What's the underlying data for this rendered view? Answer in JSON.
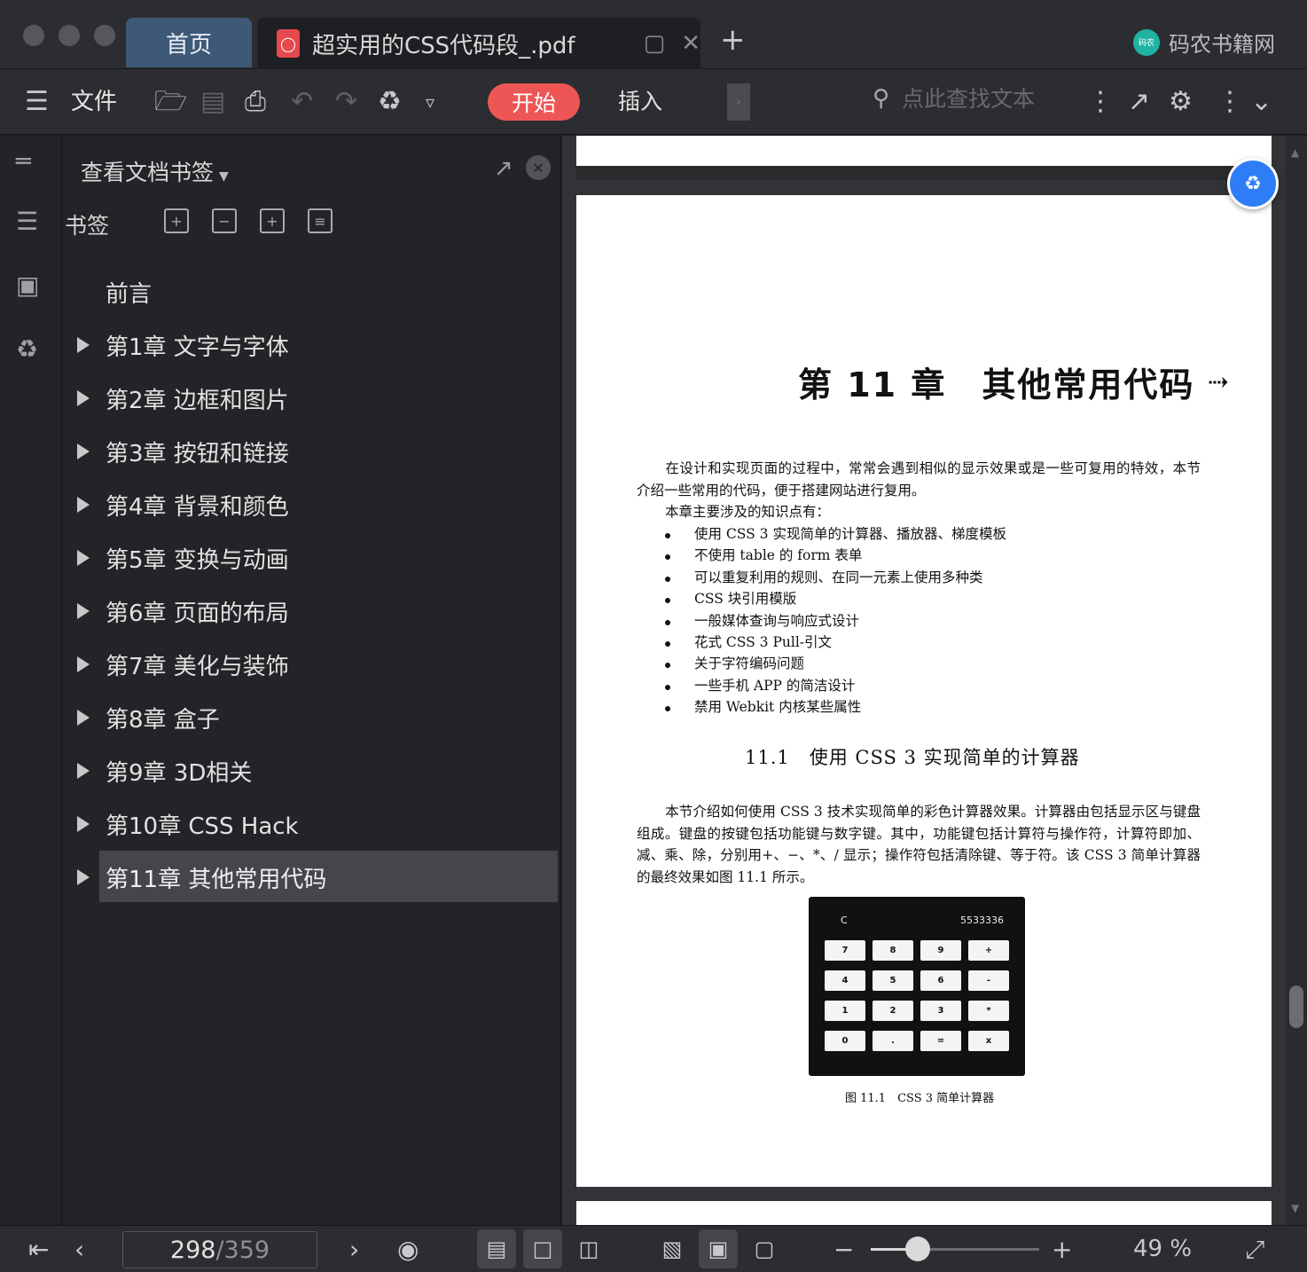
{
  "tabs": {
    "home": "首页",
    "document": "超实用的CSS代码段_.pdf",
    "brand": "码农书籍网",
    "brand_logo_text": "码农"
  },
  "toolbar": {
    "file_label": "文件",
    "start_label": "开始",
    "insert_label": "插入",
    "search_placeholder": "点此查找文本"
  },
  "panel": {
    "title": "查看文档书签",
    "bookmark_label": "书签",
    "bookmarks": [
      {
        "label": "前言",
        "expandable": false,
        "selected": false
      },
      {
        "label": "第1章 文字与字体",
        "expandable": true,
        "selected": false
      },
      {
        "label": "第2章 边框和图片",
        "expandable": true,
        "selected": false
      },
      {
        "label": "第3章 按钮和链接",
        "expandable": true,
        "selected": false
      },
      {
        "label": "第4章 背景和颜色",
        "expandable": true,
        "selected": false
      },
      {
        "label": "第5章 变换与动画",
        "expandable": true,
        "selected": false
      },
      {
        "label": "第6章 页面的布局",
        "expandable": true,
        "selected": false
      },
      {
        "label": "第7章 美化与装饰",
        "expandable": true,
        "selected": false
      },
      {
        "label": "第8章 盒子",
        "expandable": true,
        "selected": false
      },
      {
        "label": "第9章 3D相关",
        "expandable": true,
        "selected": false
      },
      {
        "label": "第10章 CSS Hack",
        "expandable": true,
        "selected": false
      },
      {
        "label": "第11章 其他常用代码",
        "expandable": true,
        "selected": true
      }
    ]
  },
  "document": {
    "chapter_title": "第 11 章　其他常用代码",
    "intro_line1": "在设计和实现页面的过程中，常常会遇到相似的显示效果或是一些可复用的特效，本节介绍一些常用的代码，便于搭建网站进行复用。",
    "intro_line2": "本章主要涉及的知识点有：",
    "bullets": [
      "使用 CSS 3 实现简单的计算器、播放器、梯度模板",
      "不使用 table 的 form 表单",
      "可以重复利用的规则、在同一元素上使用多种类",
      "CSS 块引用模版",
      "一般媒体查询与响应式设计",
      "花式 CSS 3 Pull-引文",
      "关于字符编码问题",
      "一些手机 APP 的简洁设计",
      "禁用 Webkit 内核某些属性"
    ],
    "section_title": "11.1　使用 CSS 3 实现简单的计算器",
    "section_para": "本节介绍如何使用 CSS 3 技术实现简单的彩色计算器效果。计算器由包括显示区与键盘组成。键盘的按键包括功能键与数字键。其中，功能键包括计算符与操作符，计算符即加、减、乘、除，分别用+、−、*、/ 显示；操作符包括清除键、等于符。该 CSS 3 简单计算器的最终效果如图 11.1 所示。",
    "calculator": {
      "clear": "C",
      "display": "5533336",
      "keys": [
        "7",
        "8",
        "9",
        "+",
        "4",
        "5",
        "6",
        "-",
        "1",
        "2",
        "3",
        "*",
        "0",
        ".",
        "=",
        "x"
      ]
    },
    "figure_caption": "图 11.1　CSS 3 简单计算器"
  },
  "status": {
    "current_page": "298",
    "total_pages": "/359",
    "zoom": "49 %",
    "zoom_fraction": 0.28
  }
}
